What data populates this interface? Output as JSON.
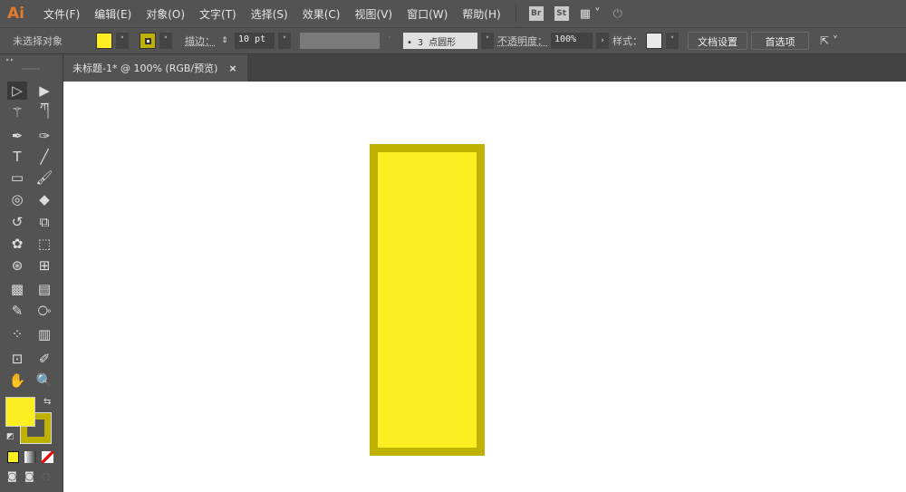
{
  "app": {
    "logo": "Ai"
  },
  "menu": [
    "文件(F)",
    "编辑(E)",
    "对象(O)",
    "文字(T)",
    "选择(S)",
    "效果(C)",
    "视图(V)",
    "窗口(W)",
    "帮助(H)"
  ],
  "menubar_icons": {
    "bridge": "Br",
    "stock": "St"
  },
  "control": {
    "selection": "未选择对象",
    "stroke_label": "描边：",
    "stroke_value": "10 pt",
    "brush": "•  3 点圆形",
    "opacity_label": "不透明度：",
    "opacity_value": "100%",
    "style_label": "样式：",
    "doc_setup": "文档设置",
    "prefs": "首选项"
  },
  "colors": {
    "fill": "#fcee21",
    "stroke": "#bfb100"
  },
  "tab": {
    "title": "未标题-1* @ 100% (RGB/预览)",
    "close": "×"
  },
  "tools": [
    "selection-tool",
    "direct-selection-tool",
    "magic-wand-tool",
    "lasso-tool",
    "pen-tool",
    "curvature-tool",
    "type-tool",
    "line-tool",
    "rectangle-tool",
    "paintbrush-tool",
    "shaper-tool",
    "eraser-tool",
    "rotate-tool",
    "scale-tool",
    "warp-tool",
    "free-transform-tool",
    "shape-builder-tool",
    "perspective-grid-tool",
    "mesh-tool",
    "gradient-tool",
    "eyedropper-tool",
    "blend-tool",
    "symbol-sprayer-tool",
    "column-graph-tool",
    "artboard-tool",
    "slice-tool",
    "hand-tool",
    "zoom-tool"
  ]
}
